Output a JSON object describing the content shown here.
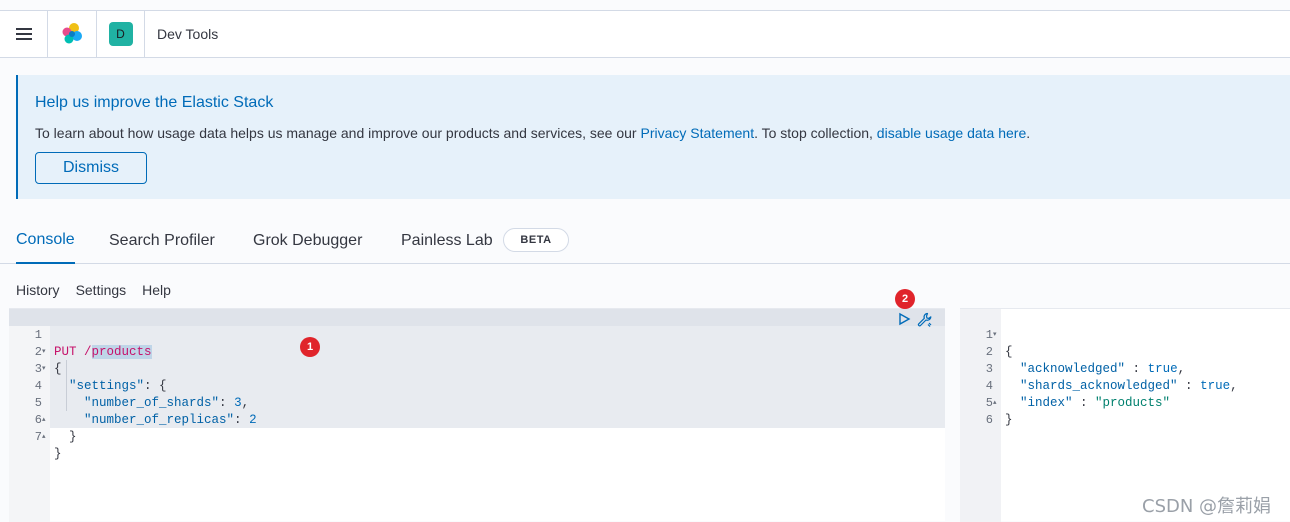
{
  "header": {
    "breadcrumb": "Dev Tools",
    "space_initial": "D",
    "space_color": "#20b2a3"
  },
  "callout": {
    "title": "Help us improve the Elastic Stack",
    "text_before": "To learn about how usage data helps us manage and improve our products and services, see our ",
    "privacy_link": "Privacy Statement",
    "text_middle": ". To stop collection, ",
    "disable_link": "disable usage data here",
    "text_after": ".",
    "dismiss_label": "Dismiss"
  },
  "tabs": [
    {
      "label": "Console",
      "active": true
    },
    {
      "label": "Search Profiler",
      "active": false
    },
    {
      "label": "Grok Debugger",
      "active": false
    },
    {
      "label": "Painless Lab",
      "active": false
    }
  ],
  "beta_label": "BETA",
  "toolbar": {
    "history": "History",
    "settings": "Settings",
    "help": "Help"
  },
  "request": {
    "line_numbers": [
      "1",
      "2",
      "3",
      "4",
      "5",
      "6",
      "7"
    ],
    "method": "PUT",
    "path_slash": "/",
    "path_name": "products",
    "l2": "{",
    "l3_key": "\"settings\"",
    "l3_rest": ": {",
    "l4_key": "\"number_of_shards\"",
    "l4_sep": ": ",
    "l4_val": "3",
    "l4_end": ",",
    "l5_key": "\"number_of_replicas\"",
    "l5_sep": ": ",
    "l5_val": "2",
    "l6": "}",
    "l7": "}"
  },
  "response": {
    "line_numbers": [
      "1",
      "2",
      "3",
      "4",
      "5",
      "6"
    ],
    "l1": "{",
    "l2_key": "\"acknowledged\"",
    "l2_sep": " : ",
    "l2_val": "true",
    "l2_end": ",",
    "l3_key": "\"shards_acknowledged\"",
    "l3_sep": " : ",
    "l3_val": "true",
    "l3_end": ",",
    "l4_key": "\"index\"",
    "l4_sep": " : ",
    "l4_val": "\"products\"",
    "l5": "}"
  },
  "badges": {
    "editor_badge": "1",
    "action_badge": "2"
  },
  "icons": {
    "menu": "hamburger-icon",
    "logo": "elastic-logo",
    "run": "play-icon",
    "wrench": "wrench-icon"
  },
  "watermark": "CSDN @詹莉娟"
}
